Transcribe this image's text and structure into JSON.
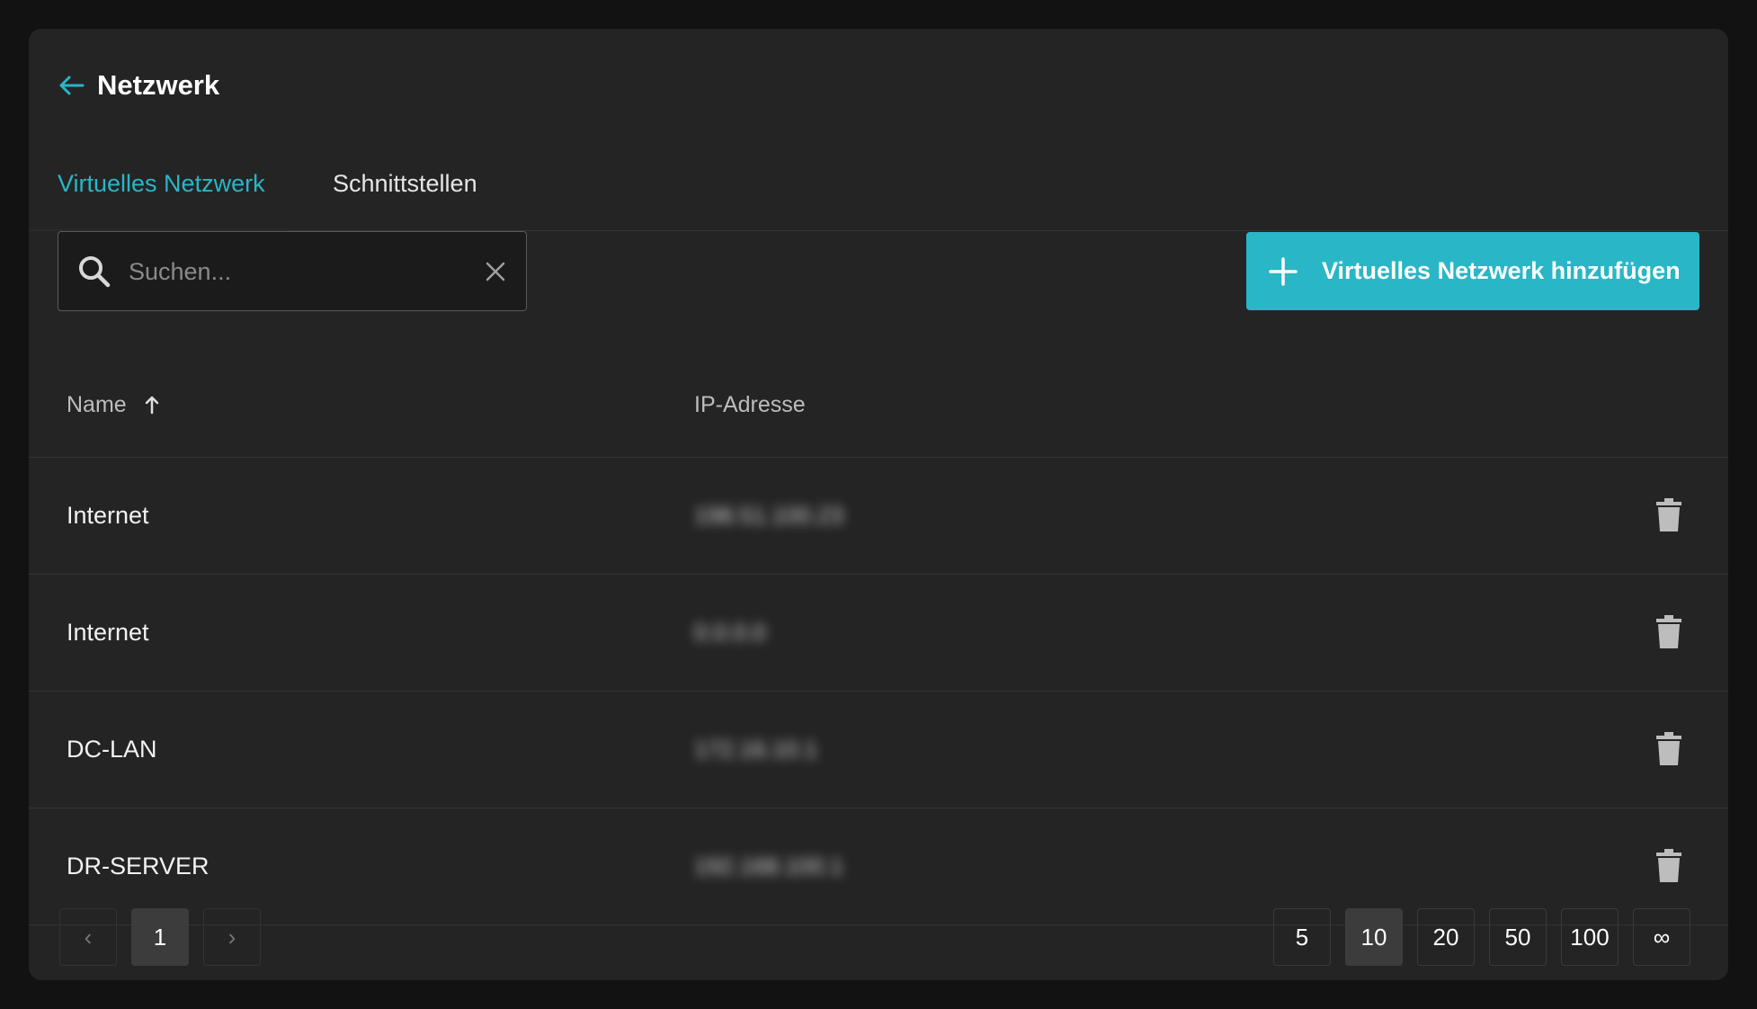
{
  "header": {
    "title": "Netzwerk",
    "back_icon": "arrow-left-icon"
  },
  "tabs": [
    {
      "label": "Virtuelles Netzwerk",
      "active": true
    },
    {
      "label": "Schnittstellen",
      "active": false
    }
  ],
  "search": {
    "placeholder": "Suchen...",
    "value": ""
  },
  "toolbar": {
    "add_label": "Virtuelles Netzwerk hinzufügen"
  },
  "table": {
    "columns": {
      "name": "Name",
      "ip": "IP-Adresse"
    },
    "sort": {
      "column": "name",
      "direction": "asc"
    },
    "rows": [
      {
        "name": "Internet",
        "ip": "198.51.100.23"
      },
      {
        "name": "Internet",
        "ip": "0.0.0.0"
      },
      {
        "name": "DC-LAN",
        "ip": "172.16.10.1"
      },
      {
        "name": "DR-SERVER",
        "ip": "192.168.100.1"
      }
    ]
  },
  "pagination": {
    "prev": "‹",
    "next": "›",
    "current_page": "1",
    "page_sizes": [
      "5",
      "10",
      "20",
      "50",
      "100",
      "∞"
    ],
    "selected_page_size": "10"
  },
  "colors": {
    "accent": "#29b6c6",
    "background": "#121212",
    "card": "#242424"
  }
}
